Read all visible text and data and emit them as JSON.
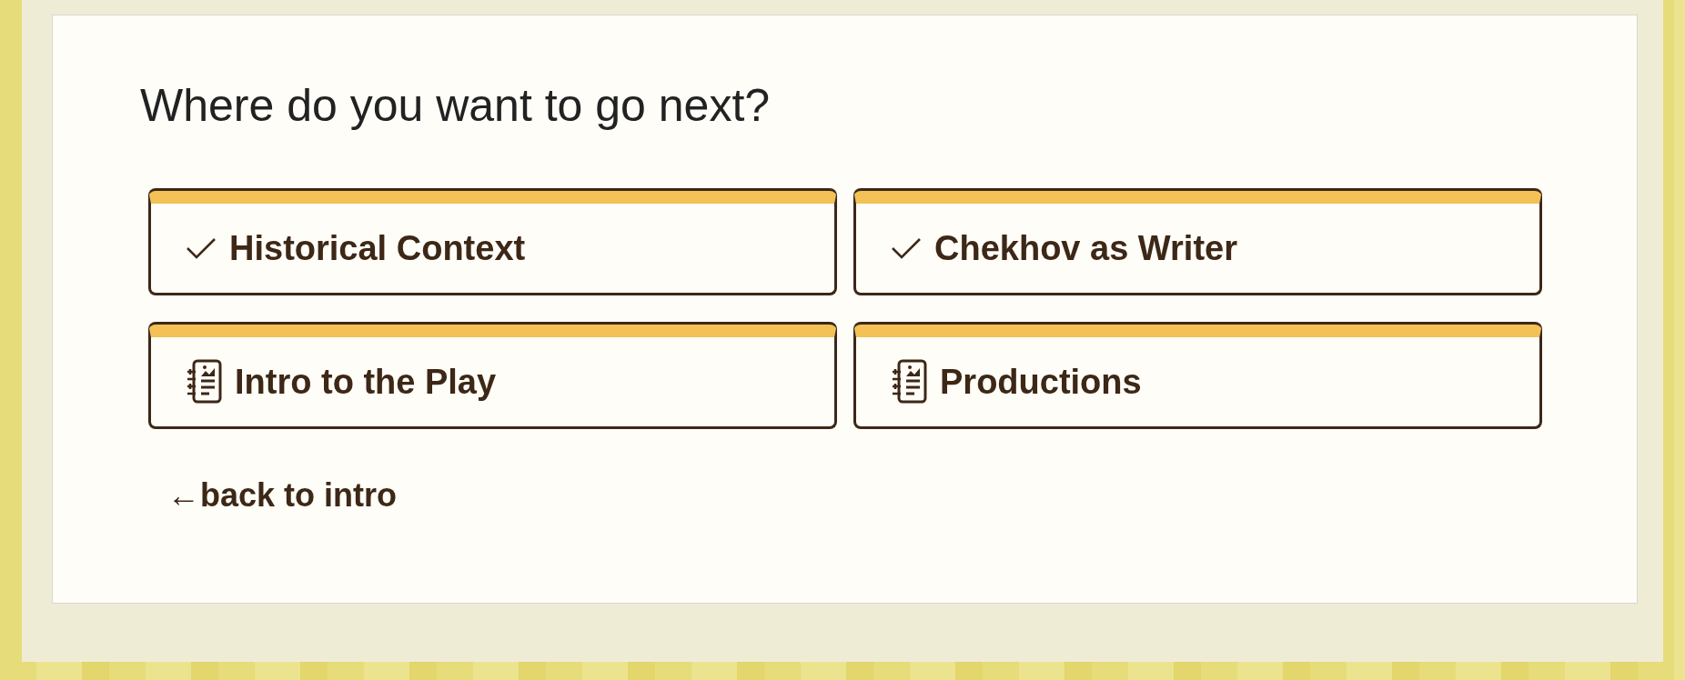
{
  "heading": "Where do you want to go next?",
  "choices": [
    {
      "label": "Historical Context",
      "completed": true
    },
    {
      "label": "Chekhov as Writer",
      "completed": true
    },
    {
      "label": "Intro to the Play",
      "completed": false
    },
    {
      "label": "Productions",
      "completed": false
    }
  ],
  "back_link": "←back to intro"
}
